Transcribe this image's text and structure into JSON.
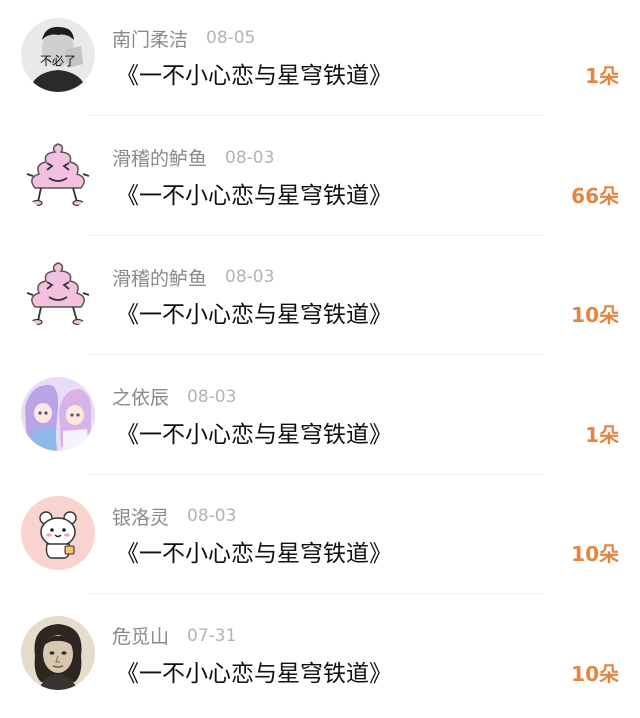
{
  "records": [
    {
      "name": "南门柔洁",
      "date": "08-05",
      "gift": "《一不小心恋与星穹铁道》",
      "count": "1朵",
      "avatar_icon": "man-with-hand-avatar-icon",
      "avatar_caption": "不必了"
    },
    {
      "name": "滑稽的鲈鱼",
      "date": "08-03",
      "gift": "《一不小心恋与星穹铁道》",
      "count": "66朵",
      "avatar_icon": "pink-poop-character-icon"
    },
    {
      "name": "滑稽的鲈鱼",
      "date": "08-03",
      "gift": "《一不小心恋与星穹铁道》",
      "count": "10朵",
      "avatar_icon": "pink-poop-character-icon"
    },
    {
      "name": "之依辰",
      "date": "08-03",
      "gift": "《一不小心恋与星穹铁道》",
      "count": "1朵",
      "avatar_icon": "anime-girls-avatar-icon"
    },
    {
      "name": "银洛灵",
      "date": "08-03",
      "gift": "《一不小心恋与星穹铁道》",
      "count": "10朵",
      "avatar_icon": "cute-bear-avatar-icon"
    },
    {
      "name": "危觅山",
      "date": "07-31",
      "gift": "《一不小心恋与星穹铁道》",
      "count": "10朵",
      "avatar_icon": "woman-portrait-avatar-icon"
    }
  ],
  "colors": {
    "count": "#e5853f",
    "name": "#8a8a8a",
    "date": "#b3b3b3",
    "title": "#111111"
  }
}
